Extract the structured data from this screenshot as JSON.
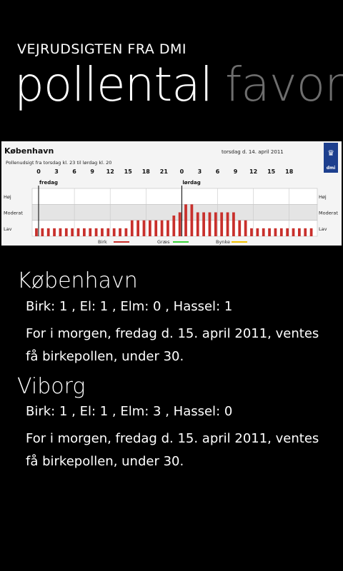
{
  "header": {
    "app_title": "VEJRUDSIGTEN FRA DMI",
    "pivot_active": "pollental",
    "pivot_next": "favori"
  },
  "chart": {
    "city": "København",
    "date": "torsdag d. 14. april 2011",
    "subtitle": "Pollenudsigt fra torsdag kl. 23 til lørdag kl. 20",
    "logo_text": "dmi",
    "hour_ticks": [
      "0",
      "3",
      "6",
      "9",
      "12",
      "15",
      "18",
      "21",
      "0",
      "3",
      "6",
      "9",
      "12",
      "15",
      "18"
    ],
    "day_labels": [
      "fredag",
      "lørdag"
    ],
    "level_labels_left": [
      "Høj",
      "Moderat",
      "Lav"
    ],
    "level_labels_right": [
      "Høj",
      "Moderat",
      "Lav"
    ],
    "legend": [
      {
        "label": "Birk",
        "color": "#c8302c"
      },
      {
        "label": "Græs",
        "color": "#3ad23a"
      },
      {
        "label": "Bynke",
        "color": "#f0c000"
      }
    ]
  },
  "chart_data": {
    "type": "bar",
    "title": "København",
    "subtitle": "Pollenudsigt fra torsdag kl. 23 til lørdag kl. 20",
    "xlabel": "",
    "ylabel": "",
    "y_levels": [
      "Lav",
      "Moderat",
      "Høj"
    ],
    "ylim": [
      0,
      3
    ],
    "series": [
      {
        "name": "Birk",
        "color": "#c8302c",
        "values": [
          0.5,
          0.5,
          0.5,
          0.5,
          0.5,
          0.5,
          0.5,
          0.5,
          0.5,
          0.5,
          0.5,
          0.5,
          0.5,
          0.5,
          0.5,
          0.5,
          1,
          1,
          1,
          1,
          1,
          1,
          1,
          1.3,
          1.5,
          2,
          2,
          1.5,
          1.5,
          1.5,
          1.5,
          1.5,
          1.5,
          1.5,
          1,
          1,
          0.5,
          0.5,
          0.5,
          0.5,
          0.5,
          0.5,
          0.5,
          0.5,
          0.5,
          0.5,
          0.5
        ]
      }
    ]
  },
  "cities": [
    {
      "name": "København",
      "counts": "Birk: 1 , El: 1 , Elm: 0 , Hassel: 1",
      "forecast": "For i  morgen, fredag d. 15. april 2011, ventes få birkepollen, under 30."
    },
    {
      "name": "Viborg",
      "counts": "Birk: 1 , El: 1 , Elm: 3 , Hassel: 0",
      "forecast": "For i  morgen, fredag d. 15. april 2011, ventes få birkepollen, under 30."
    }
  ]
}
